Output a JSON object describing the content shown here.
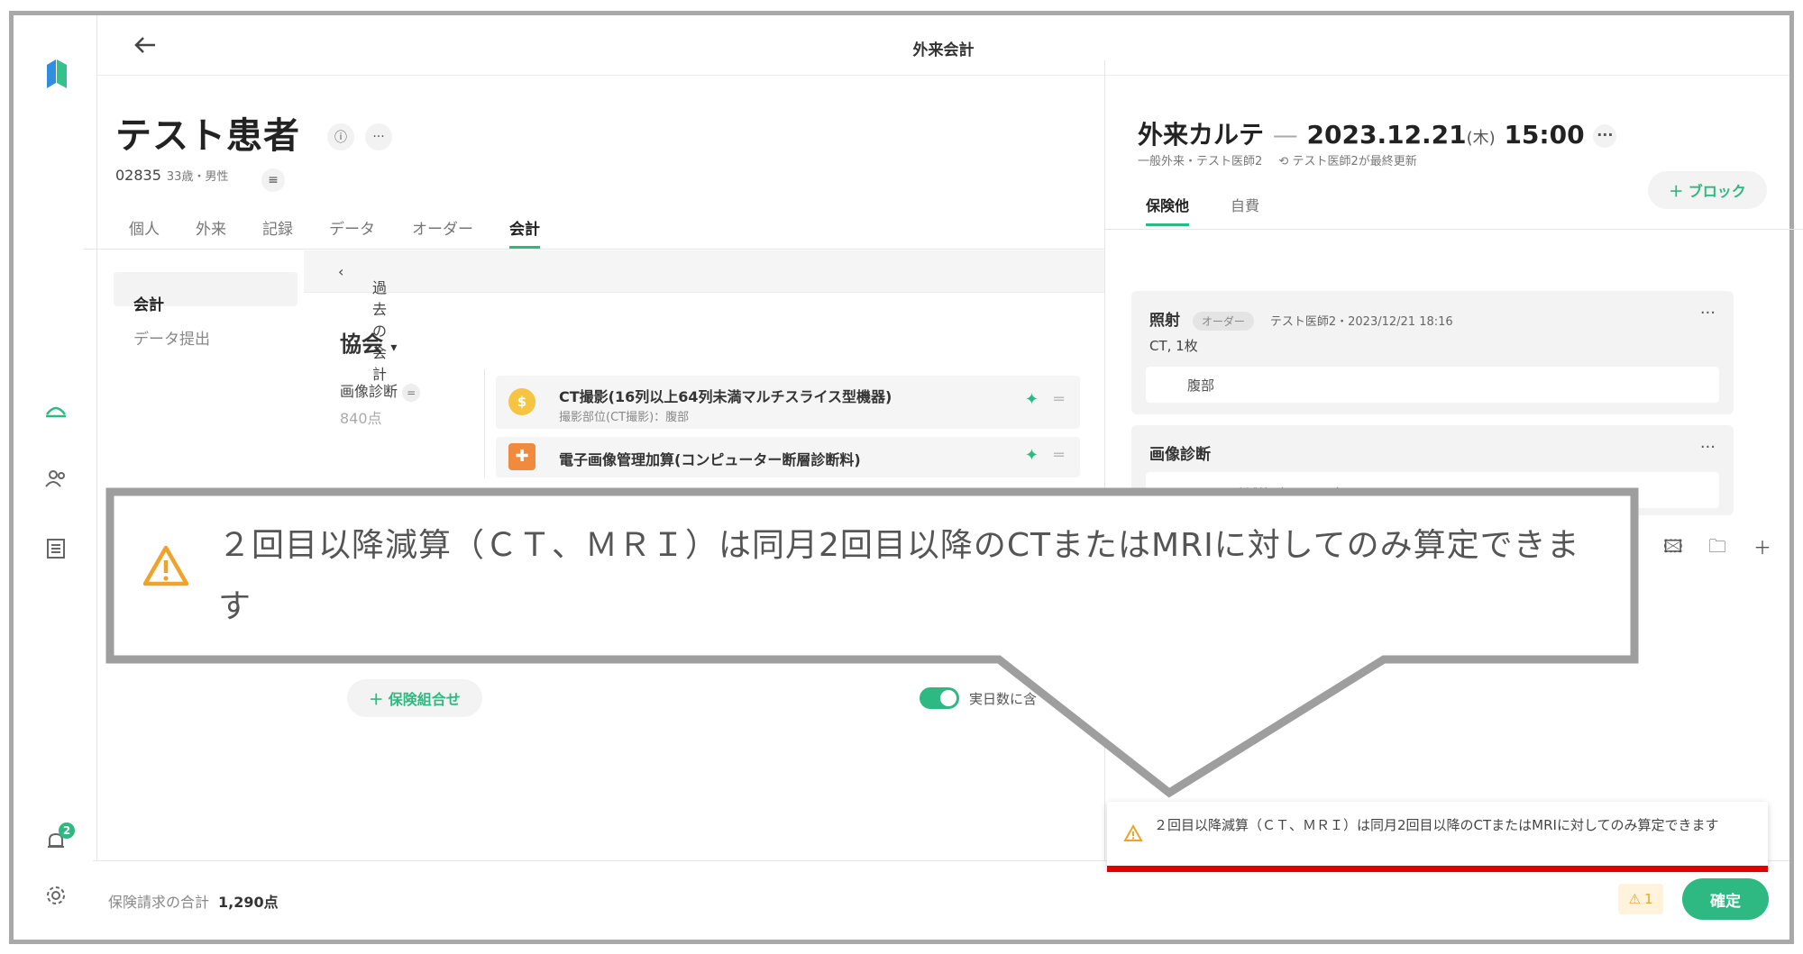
{
  "window_title": "外来会計",
  "patient": {
    "name": "テスト患者",
    "id": "02835",
    "demographics": "33歳・男性",
    "more": "···"
  },
  "tabs": [
    {
      "label": "個人"
    },
    {
      "label": "外来"
    },
    {
      "label": "記録"
    },
    {
      "label": "データ"
    },
    {
      "label": "オーダー"
    },
    {
      "label": "会計",
      "active": true
    }
  ],
  "subnav": [
    {
      "label": "会計",
      "active": true
    },
    {
      "label": "データ提出"
    }
  ],
  "past_accounts": "過去の会計",
  "association": "協会",
  "section": {
    "label": "画像診断",
    "points": "840点"
  },
  "items": [
    {
      "title": "CT撮影(16列以上64列未満マルチスライス型機器)",
      "sub": "撮影部位(CT撮影)：腹部",
      "icon": "yen-coin-icon",
      "color": "#f5c542"
    },
    {
      "title": "電子画像管理加算(コンピューター断層診断料)",
      "sub": "",
      "icon": "plus-cross-icon",
      "color": "#f08a3c"
    }
  ],
  "add_insurance": "＋ 保険組合せ",
  "toggle_label": "実日数に含",
  "karte": {
    "title": "外来カルテ",
    "dash": "—",
    "date": "2023.12.21",
    "weekday": "(木)",
    "time": "15:00",
    "more": "···",
    "subtitle": "一般外来・テスト医師2",
    "updated": "テスト医師2が最終更新",
    "tabs": [
      {
        "label": "保険他",
        "active": true
      },
      {
        "label": "自費"
      }
    ],
    "add_block": "＋ ブロック"
  },
  "cards": [
    {
      "title": "照射",
      "badge": "オーダー",
      "meta": "テスト医師2・2023/12/21 18:16",
      "line": "CT, 1枚",
      "inner": "腹部"
    },
    {
      "title": "画像診断",
      "inner": "2回目以降減算（CT、MRI）"
    }
  ],
  "footer": {
    "total_label": "保険請求の合計",
    "total_value": "1,290点",
    "warning_count": "1",
    "confirm": "確定"
  },
  "notification_badge": "2",
  "toast": {
    "message": "２回目以降減算（ＣＴ、ＭＲＩ）は同月2回目以降のCTまたはMRIに対してのみ算定できます"
  },
  "callout": {
    "message": "２回目以降減算（ＣＴ、ＭＲＩ）は同月2回目以降のCTまたはMRIに対してのみ算定できます"
  },
  "colors": {
    "accent": "#2fb982",
    "warning": "#f0a32a",
    "alert_line": "#e00000"
  }
}
